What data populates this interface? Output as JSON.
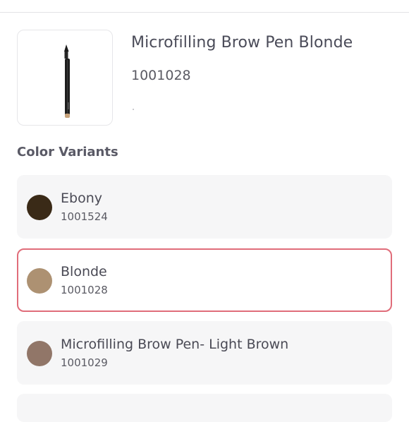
{
  "product": {
    "title": "Microfilling Brow Pen Blonde",
    "sku": "1001028",
    "image_icon": "brow-pen-image"
  },
  "variants_section": {
    "title": "Color Variants"
  },
  "variants": [
    {
      "name": "Ebony",
      "sku": "1001524",
      "color": "#3a2a17",
      "selected": false
    },
    {
      "name": "Blonde",
      "sku": "1001028",
      "color": "#ad9172",
      "selected": true
    },
    {
      "name": "Microfilling Brow Pen- Light Brown",
      "sku": "1001029",
      "color": "#917668",
      "selected": false
    }
  ],
  "colors": {
    "selected_border": "#e06d7a",
    "card_background": "#f6f6f7"
  }
}
